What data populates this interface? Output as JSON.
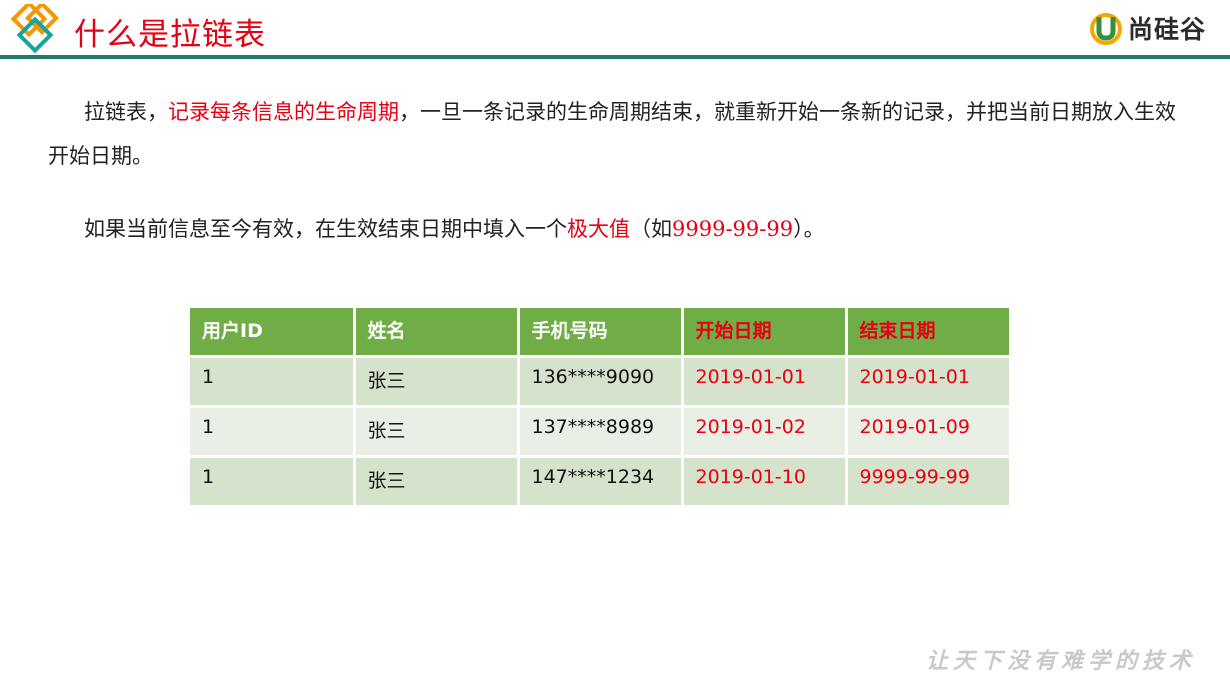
{
  "header": {
    "title": "什么是拉链表",
    "brand_name": "尚硅谷",
    "colors": {
      "title": "#e60012",
      "rule": "#1f7a6d",
      "diamond_orange": "#f39800",
      "diamond_teal": "#1aa39a"
    }
  },
  "content": {
    "p1_a": "拉链表，",
    "p1_highlight": "记录每条信息的生命周期",
    "p1_b": "，一旦一条记录的生命周期结束，就重新开始一条新的记录，并把当前日期放入生效开始日期。",
    "p2_a": "如果当前信息至今有效，在生效结束日期中填入一个",
    "p2_highlight": "极大值",
    "p2_b": "（如",
    "p2_value": "9999-99-99",
    "p2_c": "）。"
  },
  "table": {
    "headers": [
      "用户ID",
      "姓名",
      "手机号码",
      "开始日期",
      "结束日期"
    ],
    "rows": [
      [
        "1",
        "张三",
        "136****9090",
        "2019-01-01",
        "2019-01-01"
      ],
      [
        "1",
        "张三",
        "137****8989",
        "2019-01-02",
        "2019-01-09"
      ],
      [
        "1",
        "张三",
        "147****1234",
        "2019-01-10",
        "9999-99-99"
      ]
    ],
    "colors": {
      "header": "#70ad47",
      "row_odd": "#d5e2cc",
      "row_even": "#e9efe5",
      "highlight": "#e60012"
    }
  },
  "footer": {
    "slogan": "让天下没有难学的技术"
  }
}
